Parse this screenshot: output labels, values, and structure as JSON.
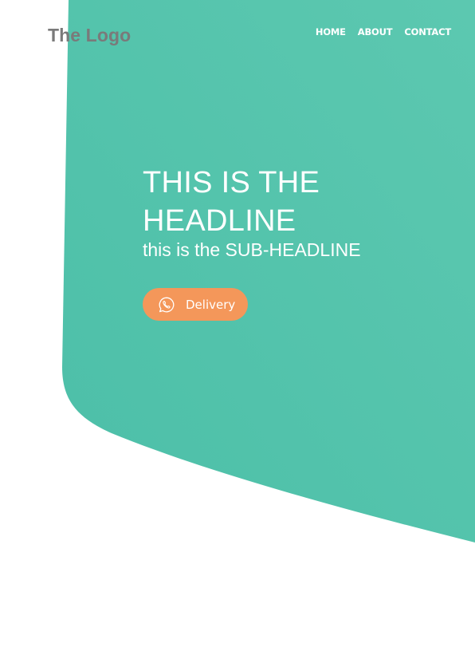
{
  "header": {
    "logo_text": "The Logo",
    "nav": [
      {
        "label": "HOME"
      },
      {
        "label": "ABOUT"
      },
      {
        "label": "CONTACT"
      }
    ]
  },
  "hero": {
    "headline_line1": "THIS IS THE",
    "headline_line2": "HEADLINE",
    "subheadline": "this is the SUB-HEADLINE",
    "cta": {
      "label": "Delivery",
      "icon": "whatsapp-icon"
    }
  },
  "colors": {
    "hero_gradient_start": "#5cc8b0",
    "hero_gradient_end": "#4cbfa8",
    "cta_background": "#f4975a",
    "logo_text": "#7a7a7a",
    "text_on_hero": "#ffffff"
  }
}
